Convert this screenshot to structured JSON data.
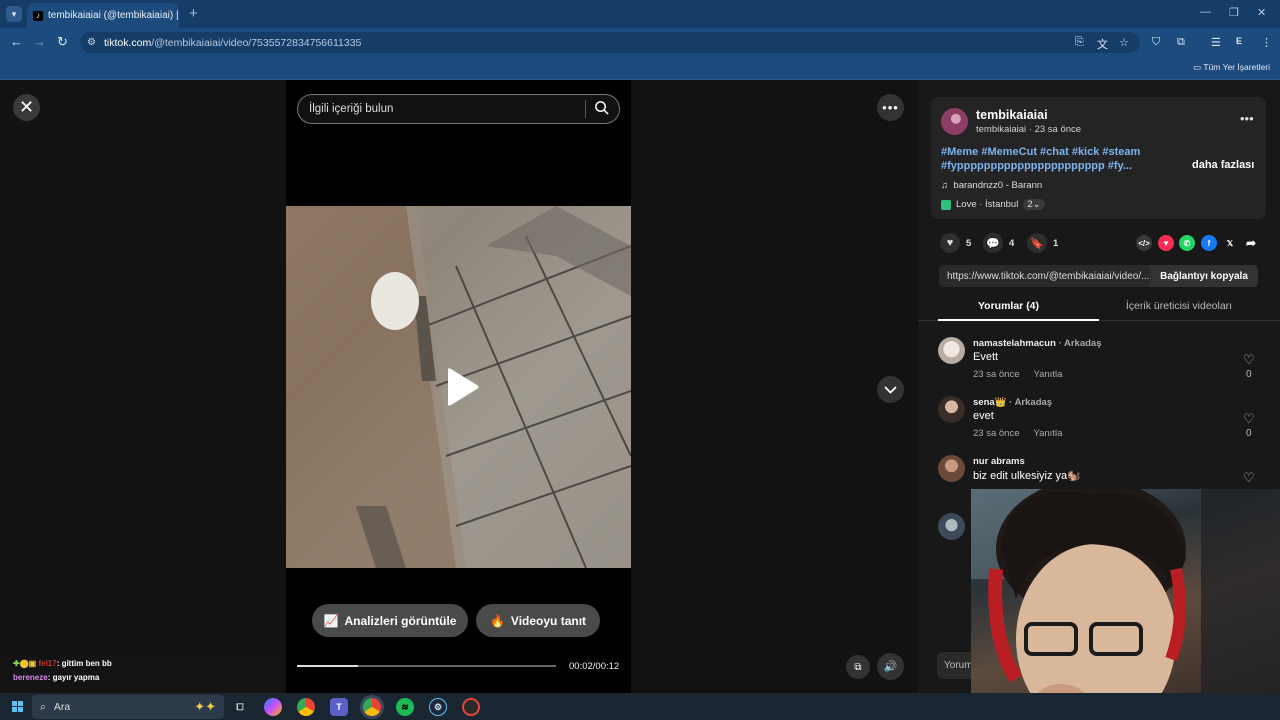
{
  "browser": {
    "tab_title": "tembikaiaiai (@tembikaiaiai) | T",
    "url_host": "tiktok.com",
    "url_path": "/@tembikaiaiai/video/7535572834756611335",
    "bookmarks_all": "Tüm Yer İşaretleri",
    "profile_initial": "E"
  },
  "player": {
    "search_placeholder": "İlgili içeriği bulun",
    "analytics_button": "Analizleri görüntüle",
    "promote_button": "Videoyu tanıt",
    "time": "00:02/00:12",
    "progress": 0.235
  },
  "chat": {
    "line1_user": "fel17",
    "line1_text": ": gittim ben bb",
    "line2_user": "bereneze",
    "line2_text": ": gayır yapma"
  },
  "post": {
    "author": "tembikaiaiai",
    "author_sub": "tembikaiaiai · 23 sa önce",
    "tags_line1": "#Meme #MemeCut #chat #kick #steam",
    "tags_line2": "#fypppppppppppppppppppppp #fy...",
    "more": "daha fazlası",
    "music": "barandnzz0 - Barann",
    "location": "Love · İstanbul",
    "location_count": "2",
    "likes": "5",
    "comments": "4",
    "saves": "1",
    "link": "https://www.tiktok.com/@tembikaiaiai/video/...",
    "copy_button": "Bağlantıyı kopyala"
  },
  "tabs": {
    "comments": "Yorumlar (4)",
    "creator_videos": "İçerik üreticisi videoları"
  },
  "comments": [
    {
      "name": "namastelahmacun",
      "tag": " · Arkadaş",
      "text": "Evett",
      "time": "23 sa önce",
      "reply": "Yanıtla",
      "likes": "0"
    },
    {
      "name": "sena👑",
      "tag": " · Arkadaş",
      "text": "evet",
      "time": "23 sa önce",
      "reply": "Yanıtla",
      "likes": "0"
    },
    {
      "name": "nur abrams",
      "tag": "",
      "text": "biz edit ulkesiyiz ya🐿️",
      "time": "",
      "reply": "",
      "likes": ""
    }
  ],
  "comment_input_placeholder": "Yorum",
  "taskbar": {
    "search": "Ara"
  },
  "colors": {
    "accent_link": "#7bb4ef",
    "chrome": "#1e4b7d",
    "taskbar": "#1b2633"
  }
}
